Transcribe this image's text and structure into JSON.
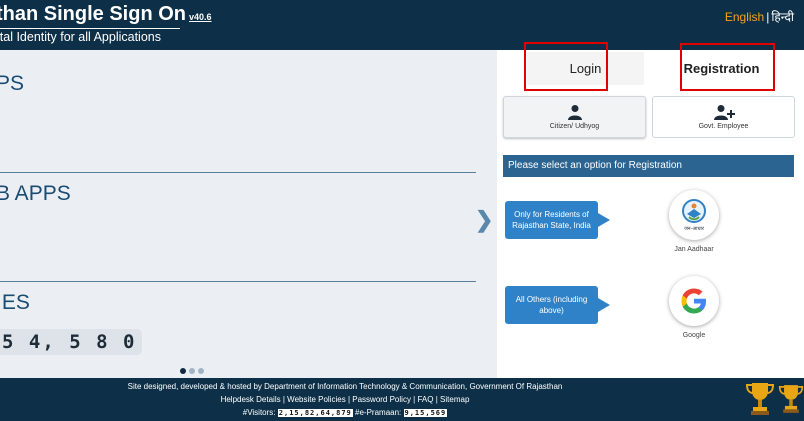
{
  "header": {
    "title": "than Single Sign On",
    "version": "v40.6",
    "tagline": "ital Identity for all Applications",
    "lang_english": "English",
    "lang_separator": "|",
    "lang_hindi": "हिन्दी"
  },
  "left": {
    "section1_title": "PS",
    "section2_title": "B APPS",
    "section3_title": "IES",
    "counter_value": "5 4, 5 8 0",
    "slider_arrow": "❯",
    "dots": [
      true,
      false,
      false
    ]
  },
  "auth": {
    "tab_login": "Login",
    "tab_registration": "Registration",
    "option_citizen": "Citizen/ Udhyog",
    "option_govt": "Govt. Employee",
    "select_prompt": "Please select an option for Registration",
    "callout_residents": "Only for Residents of Rajasthan State, India",
    "callout_others": "All Others (including above)",
    "jan_aadhaar_caption": "Jan Aadhaar",
    "jan_aadhaar_logo_text": "जन-आधार",
    "google_caption": "Google"
  },
  "footer": {
    "line1": "Site designed, developed & hosted by Department of Information Technology & Communication, Government Of Rajasthan",
    "link_helpdesk": "Helpdesk Details",
    "link_policies": "Website Policies",
    "link_password": "Password Policy",
    "link_faq": "FAQ",
    "link_sitemap": "Sitemap",
    "link_separator": "|",
    "visitors_label": "#Visitors:",
    "visitors_value": "2,15,82,64,879",
    "epramaan_label": "#e-Pramaan:",
    "epramaan_value": "9,15,569"
  },
  "colors": {
    "header_bg": "#0d3048",
    "accent_orange": "#f6a21a",
    "registration_bar": "#2b6491",
    "callout_blue": "#2f82c8",
    "highlight_red": "#e00000"
  },
  "icons": [
    "user-icon",
    "user-plus-icon",
    "chevron-right-icon",
    "trophy-icon",
    "google-logo",
    "jan-aadhaar-logo"
  ]
}
